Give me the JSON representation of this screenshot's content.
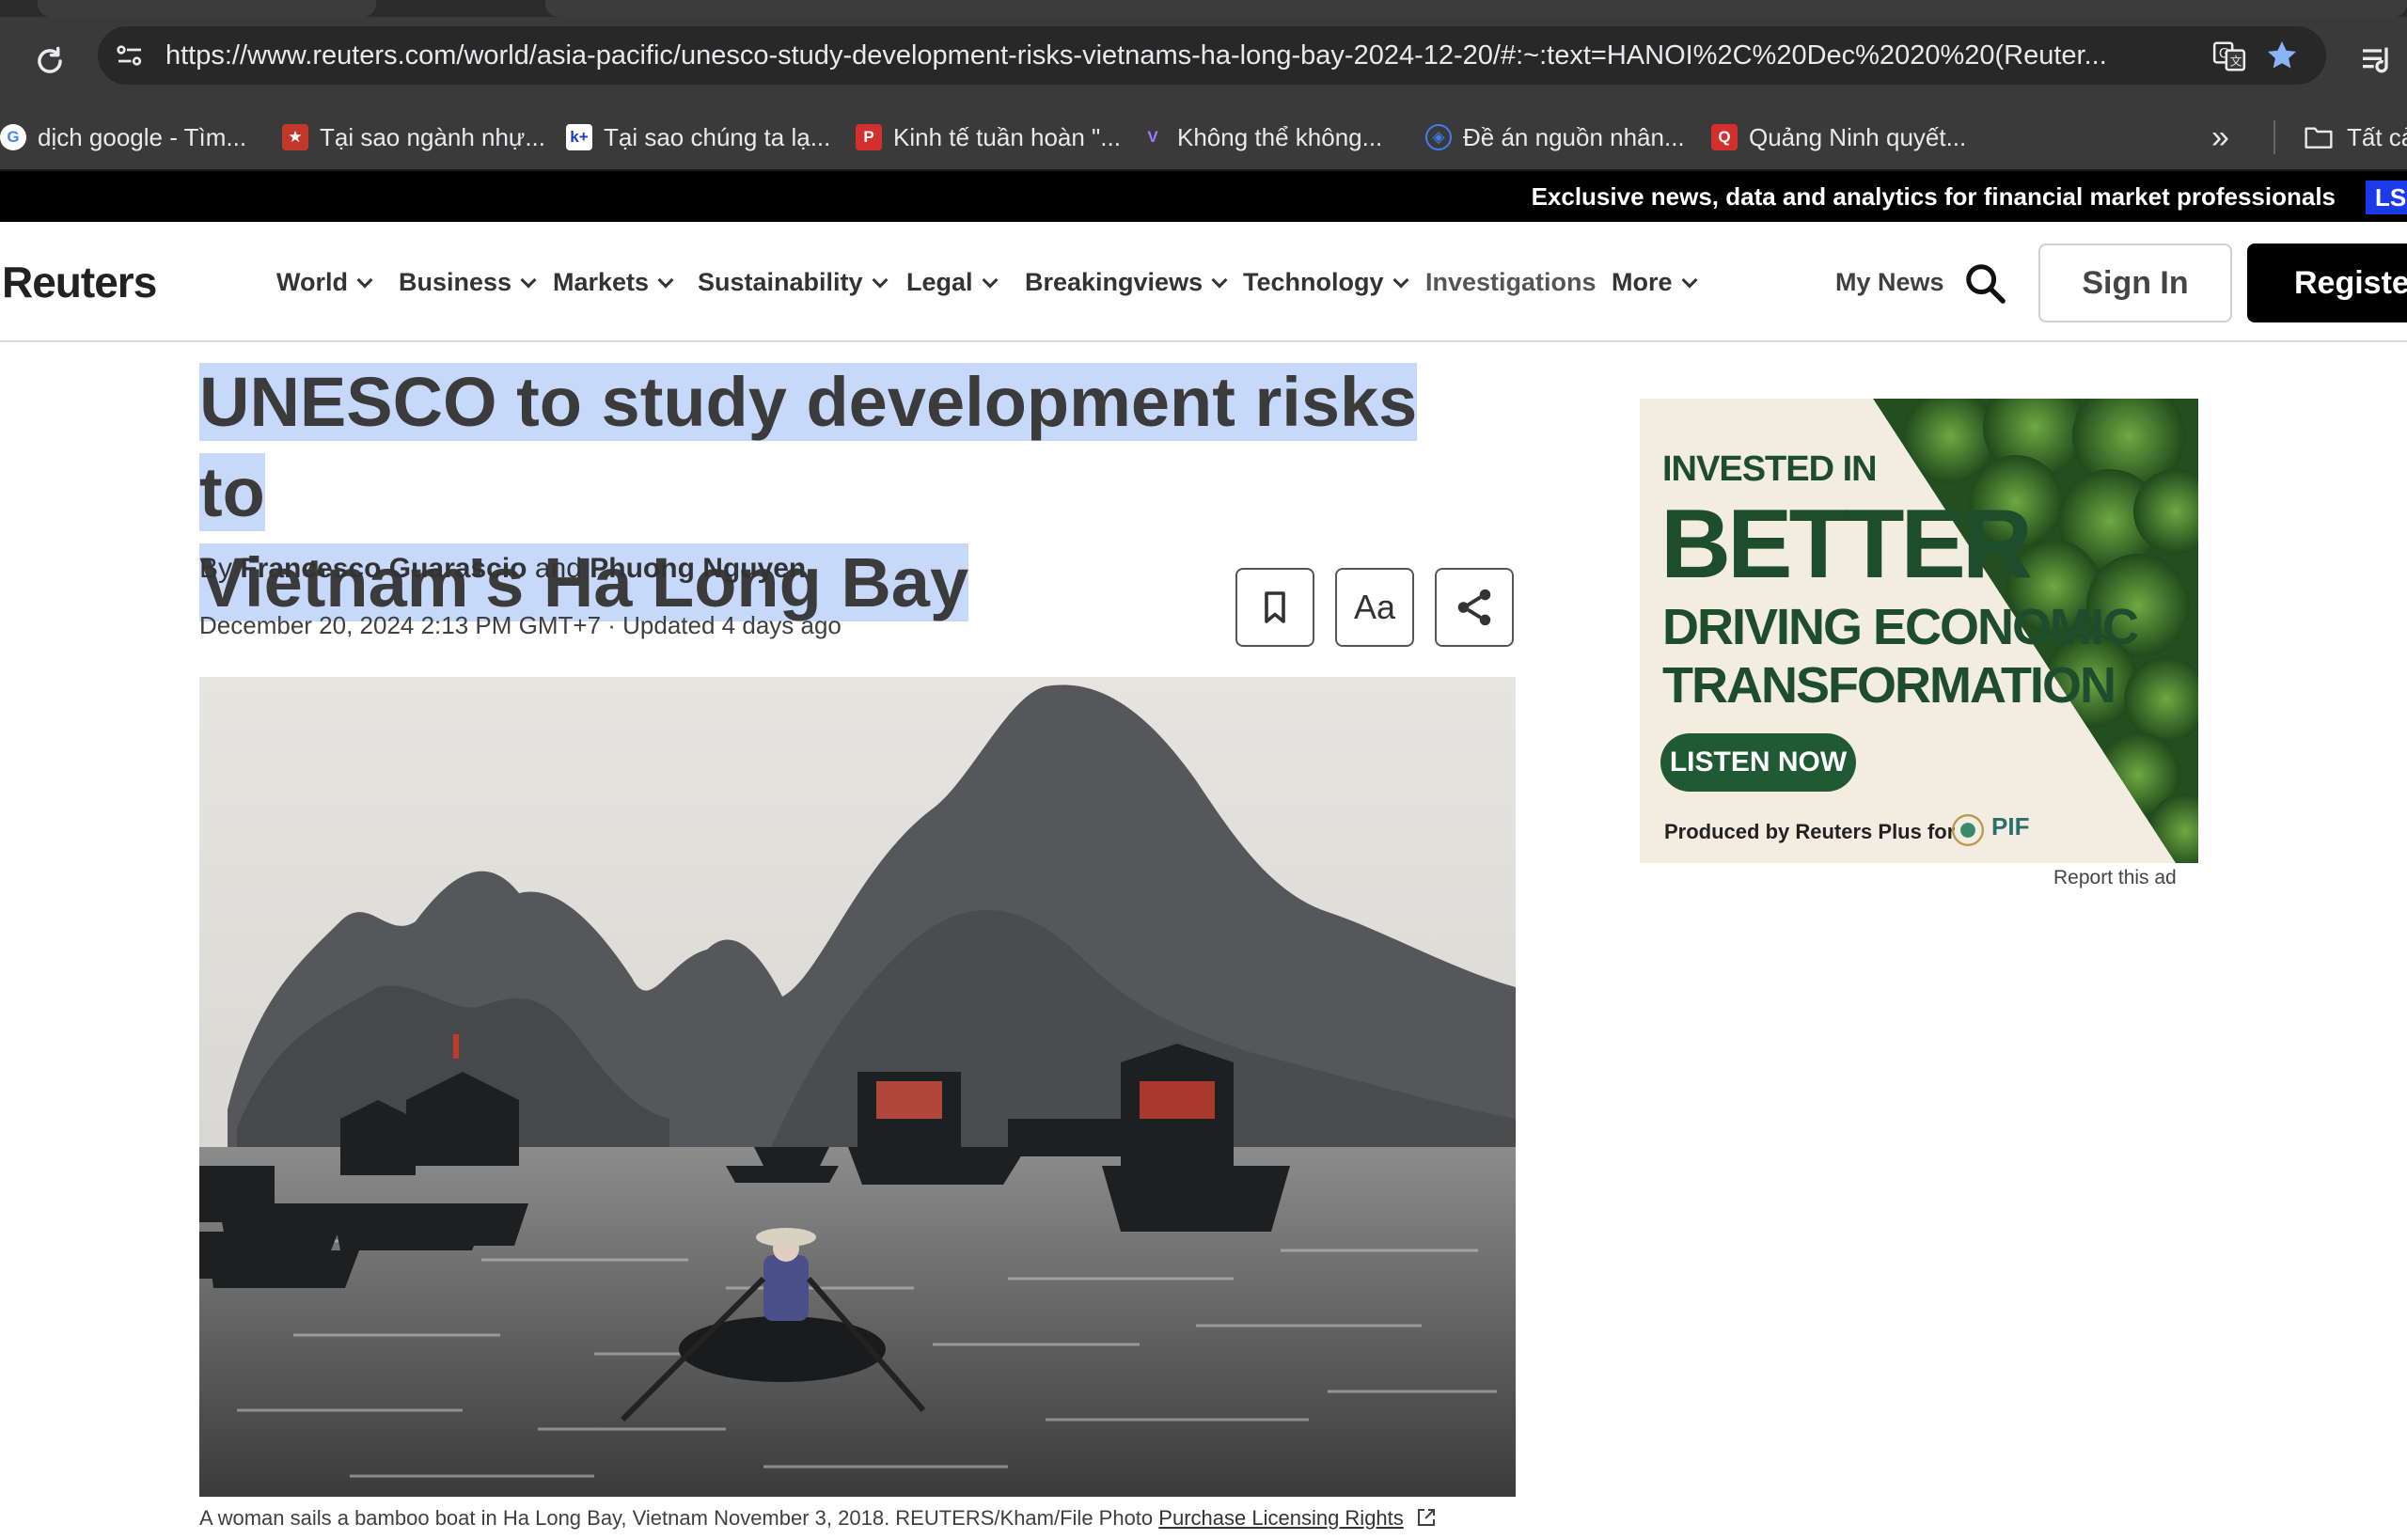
{
  "browser": {
    "url": "https://www.reuters.com/world/asia-pacific/unesco-study-development-risks-vietnams-ha-long-bay-2024-12-20/#:~:text=HANOI%2C%20Dec%2020%20(Reuter...",
    "bookmarks": [
      {
        "label": "dịch google - Tìm...",
        "icon": "google-icon",
        "color": "#4285f4"
      },
      {
        "label": "Tại sao ngành nhự...",
        "icon": "badge-icon",
        "color": "#c0392b"
      },
      {
        "label": "Tại sao chúng ta lạ...",
        "icon": "k-plus-icon",
        "color": "#1a3fc9"
      },
      {
        "label": "Kinh tế tuần hoàn \"...",
        "icon": "flag-icon",
        "color": "#d32f2f"
      },
      {
        "label": "Không thể không...",
        "icon": "vtv-icon",
        "color": "#7b5cff"
      },
      {
        "label": "Đề án nguồn nhân...",
        "icon": "globe-icon",
        "color": "#3f7de8"
      },
      {
        "label": "Quảng Ninh quyết...",
        "icon": "news-icon",
        "color": "#d32f2f"
      }
    ],
    "bookmarks_folder": "Tất cả"
  },
  "promo": {
    "text": "Exclusive news, data and analytics for financial market professionals",
    "badge": "LS"
  },
  "nav": {
    "logo": "Reuters",
    "items": [
      "World",
      "Business",
      "Markets",
      "Sustainability",
      "Legal",
      "Breakingviews",
      "Technology",
      "Investigations",
      "More"
    ],
    "my_news": "My News",
    "sign_in": "Sign In",
    "register": "Register"
  },
  "article": {
    "headline_line1": "UNESCO to study development risks to",
    "headline_line2": "Vietnam's Ha Long Bay",
    "by": "By",
    "author1": "Francesco Guarascio",
    "and": "and",
    "author2": "Phuong Nguyen",
    "dateline": "December 20, 2024 2:13 PM GMT+7 · Updated 4 days ago",
    "font_button": "Aa",
    "caption": "A woman sails a bamboo boat in Ha Long Bay, Vietnam November 3, 2018. REUTERS/Kham/File Photo",
    "licensing": "Purchase Licensing Rights"
  },
  "ad": {
    "line1": "INVESTED IN",
    "line2": "BETTER",
    "line3": "DRIVING ECONOMIC",
    "line4": "TRANSFORMATION",
    "button": "LISTEN NOW",
    "credit": "Produced by Reuters Plus for",
    "sponsor": "PIF",
    "report": "Report this ad"
  }
}
